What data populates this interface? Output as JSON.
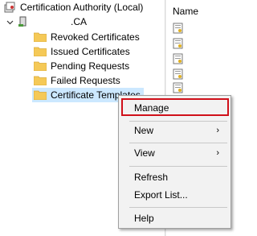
{
  "tree": {
    "root_label": "Certification Authority (Local)",
    "ca_label": ".CA",
    "items": [
      {
        "label": "Revoked Certificates"
      },
      {
        "label": "Issued Certificates"
      },
      {
        "label": "Pending Requests"
      },
      {
        "label": "Failed Requests"
      },
      {
        "label": "Certificate Templates"
      }
    ],
    "selected_item": "Certificate Templates"
  },
  "right_pane": {
    "column_header": "Name",
    "item_icons": [
      "template-icon",
      "template-icon",
      "template-icon",
      "template-icon",
      "template-icon"
    ]
  },
  "context_menu": {
    "items": [
      {
        "label": "Manage",
        "highlighted": true
      },
      {
        "label": "New",
        "submenu": true
      },
      {
        "label": "View",
        "submenu": true
      },
      {
        "label": "Refresh"
      },
      {
        "label": "Export List..."
      },
      {
        "label": "Help"
      }
    ],
    "submenu_arrow": "›",
    "highlight_color": "#d0101a"
  },
  "colors": {
    "selection": "#cce8ff",
    "folder": "#f5c957",
    "menu_background": "#f2f2f2"
  }
}
